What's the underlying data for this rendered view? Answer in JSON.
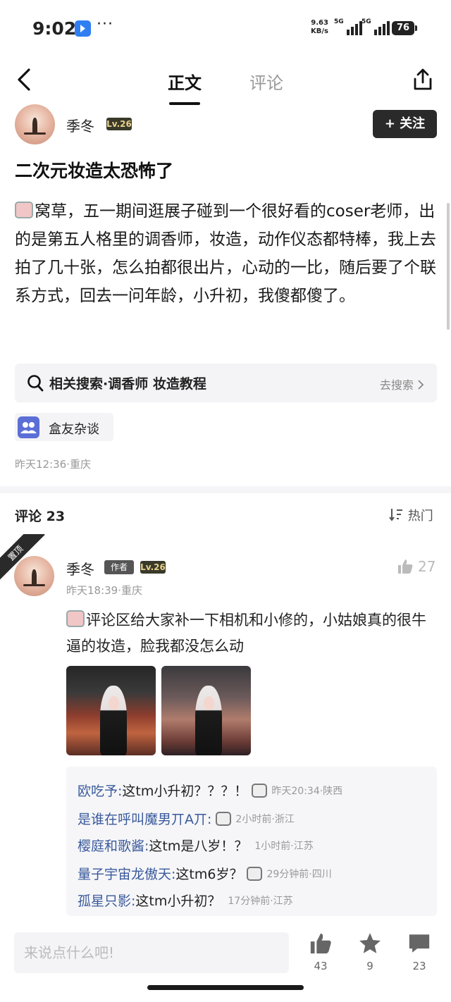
{
  "status_bar": {
    "time": "9:02",
    "net_speed_value": "9.63",
    "net_speed_unit": "KB/s",
    "signal1_label": "5G",
    "signal2_label": "5G",
    "battery": "76"
  },
  "nav": {
    "tab_article": "正文",
    "tab_comments": "评论"
  },
  "post": {
    "author_name": "季冬",
    "author_level": "Lv.26",
    "follow_label": "+ 关注",
    "title": "二次元妆造太恐怖了",
    "body": "窝草，五一期间逛展子碰到一个很好看的coser老师，出的是第五人格里的调香师，妆造，动作仪态都特棒，我上去拍了几十张，怎么拍都很出片，心动的一比，随后要了个联系方式，回去一问年龄，小升初，我傻都傻了。",
    "related_search": "相关搜索·调香师 妆造教程",
    "go_search": "去搜索",
    "topic_tag": "盒友杂谈",
    "meta": "昨天12:36·重庆"
  },
  "comments": {
    "header": "评论 23",
    "sort_label": "热门",
    "pinned_label": "置顶",
    "top_comment": {
      "author": "季冬",
      "author_badge": "作者",
      "level": "Lv.26",
      "likes": "27",
      "meta": "昨天18:39·重庆",
      "text": "评论区给大家补一下相机和小修的，小姑娘真的很牛逼的妆造，脸我都没怎么动"
    },
    "replies": [
      {
        "user": "欧吃予:",
        "text": "这tm小升初？？？！",
        "meta": "昨天20:34·陕西"
      },
      {
        "user": "是谁在呼叫魔男丌A丌:",
        "text": "",
        "meta": "2小时前·浙江"
      },
      {
        "user": "樱庭和歌酱:",
        "text": "这tm是八岁！？",
        "meta": "1小时前·江苏"
      },
      {
        "user": "量子宇宙龙傲天:",
        "text": "这tm6岁？",
        "meta": "29分钟前·四川"
      },
      {
        "user": "孤星只影:",
        "text": "这tm小升初？",
        "meta": "17分钟前·江苏"
      }
    ]
  },
  "bottom_bar": {
    "input_placeholder": "来说点什么吧!",
    "likes": "43",
    "favorites": "9",
    "comments": "23"
  }
}
